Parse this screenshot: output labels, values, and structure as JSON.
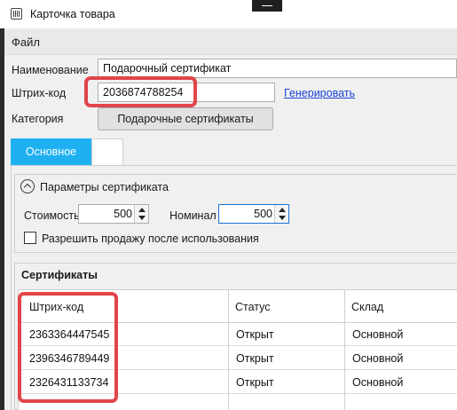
{
  "window": {
    "title": "Карточка товара",
    "icon": "barcode-grid-icon"
  },
  "menu": {
    "file": "Файл"
  },
  "form": {
    "name_label": "Наименование",
    "name_value": "Подарочный сертификат",
    "barcode_label": "Штрих-код",
    "barcode_value": "2036874788254",
    "generate_link": "Генерировать",
    "category_label": "Категория",
    "category_value": "Подарочные сертификаты"
  },
  "tabs": [
    {
      "label": "Основное",
      "active": true
    },
    {
      "label": "",
      "active": false
    }
  ],
  "params": {
    "header": "Параметры сертификата",
    "cost_label": "Стоимость",
    "cost_value": "500",
    "nominal_label": "Номинал",
    "nominal_value": "500",
    "allow_sale_label": "Разрешить продажу после использования",
    "allow_sale_checked": false
  },
  "certificates": {
    "title": "Сертификаты",
    "columns": [
      "Штрих-код",
      "Статус",
      "Склад"
    ],
    "rows": [
      [
        "2363364447545",
        "Открыт",
        "Основной"
      ],
      [
        "2396346789449",
        "Открыт",
        "Основной"
      ],
      [
        "2326431133734",
        "Открыт",
        "Основной"
      ]
    ]
  },
  "colors": {
    "accent_tab": "#1fb0f2",
    "link": "#1a44d6",
    "annotation": "#e0454a"
  }
}
